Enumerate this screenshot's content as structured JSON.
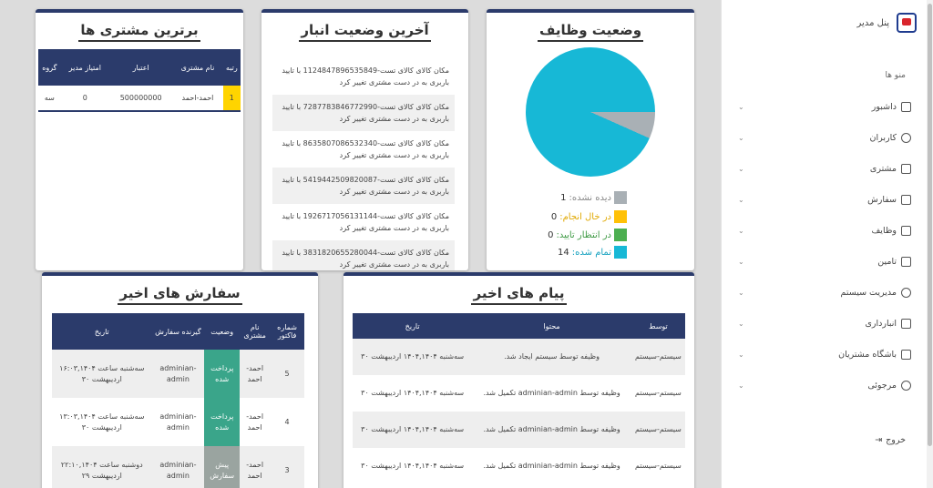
{
  "sidebar": {
    "brand": "پنل مدیر",
    "menu_heading": "منو ها",
    "items": [
      {
        "label": "داشبور"
      },
      {
        "label": "کاربران"
      },
      {
        "label": "مشتری"
      },
      {
        "label": "سفارش"
      },
      {
        "label": "وظایف"
      },
      {
        "label": "تامین"
      },
      {
        "label": "مدیریت سیستم"
      },
      {
        "label": "انبارداری"
      },
      {
        "label": "باشگاه مشتریان"
      },
      {
        "label": "مرجوئی"
      }
    ],
    "logout": "خروج"
  },
  "tasks": {
    "title": "وضعیت وظایف",
    "legend": [
      {
        "label": "دیده نشده:",
        "value": "1",
        "color": "#a9b0b5"
      },
      {
        "label": "در خال انجام:",
        "value": "0",
        "color": "#ffc107"
      },
      {
        "label": "در انتظار تایید:",
        "value": "0",
        "color": "#4caf50"
      },
      {
        "label": "تمام شده:",
        "value": "14",
        "color": "#17b8d6"
      }
    ]
  },
  "chart_data": {
    "type": "pie",
    "categories": [
      "دیده نشده",
      "در خال انجام",
      "در انتظار تایید",
      "تمام شده"
    ],
    "values": [
      1,
      0,
      0,
      14
    ],
    "colors": [
      "#a9b0b5",
      "#ffc107",
      "#4caf50",
      "#17b8d6"
    ]
  },
  "warehouse": {
    "title": "آخرین وضعیت انبار",
    "items": [
      "مکان کالای کالای تست-1124847896535849 با تایید باربری به در دست مشتری تغییر کرد",
      "مکان کالای کالای تست-7287783846772990 با تایید باربری به در دست مشتری تغییر کرد",
      "مکان کالای کالای تست-8635807086532340 با تایید باربری به در دست مشتری تغییر کرد",
      "مکان کالای کالای تست-5419442509820087 با تایید باربری به در دست مشتری تغییر کرد",
      "مکان کالای کالای تست-1926717056131144 با تایید باربری به در دست مشتری تغییر کرد",
      "مکان کالای کالای تست-3831820655280044 با تایید باربری به در دست مشتری تغییر کرد"
    ]
  },
  "customers": {
    "title": "برترین مشتری ها",
    "headers": [
      "رتبه",
      "نام مشتری",
      "اعتبار",
      "امتیاز مدیر",
      "گروه"
    ],
    "rows": [
      {
        "rank": "1",
        "name": "احمد-احمد",
        "credit": "500000000",
        "score": "0",
        "group": "سه"
      }
    ]
  },
  "orders": {
    "title": "سفارش های اخیر",
    "headers": [
      "شماره فاکتور",
      "نام مشتری",
      "وضعیت",
      "گیرنده سفارش",
      "تاریخ"
    ],
    "rows": [
      {
        "invoice": "5",
        "customer": "احمد-احمد",
        "status": "پرداخت شده",
        "receiver": "adminian-admin",
        "date": "سه‌شنبه ساعت ۱۶:۰۳,۱۴۰۴ اردیبهشت ۳۰",
        "status_kind": "paid"
      },
      {
        "invoice": "4",
        "customer": "احمد-احمد",
        "status": "پرداخت شده",
        "receiver": "adminian-admin",
        "date": "سه‌شنبه ساعت ۱۳:۰۳,۱۴۰۴ اردیبهشت ۳۰",
        "status_kind": "paid"
      },
      {
        "invoice": "3",
        "customer": "احمد-احمد",
        "status": "پیش سفارش",
        "receiver": "adminian-admin",
        "date": "دوشنبه ساعت ۲۲:۱۰,۱۴۰۴ اردیبهشت ۲۹",
        "status_kind": "pre"
      }
    ]
  },
  "messages": {
    "title": "پیام های اخیر",
    "headers": [
      "توسط",
      "محتوا",
      "تاریخ"
    ],
    "rows": [
      {
        "by": "سیستم-سیستم",
        "content": "وظیفه توسط سیستم ایجاد شد.",
        "date": "سه‌شنبه ۱۴۰۴,۱۴۰۴ اردیبهشت ۳۰"
      },
      {
        "by": "سیستم-سیستم",
        "content": "وظیفه توسط adminian-admin تکمیل شد.",
        "date": "سه‌شنبه ۱۴۰۴,۱۴۰۴ اردیبهشت ۳۰"
      },
      {
        "by": "سیستم-سیستم",
        "content": "وظیفه توسط adminian-admin تکمیل شد.",
        "date": "سه‌شنبه ۱۴۰۴,۱۴۰۴ اردیبهشت ۳۰"
      },
      {
        "by": "سیستم-سیستم",
        "content": "وظیفه توسط adminian-admin تکمیل شد.",
        "date": "سه‌شنبه ۱۴۰۴,۱۴۰۴ اردیبهشت ۳۰"
      }
    ]
  }
}
